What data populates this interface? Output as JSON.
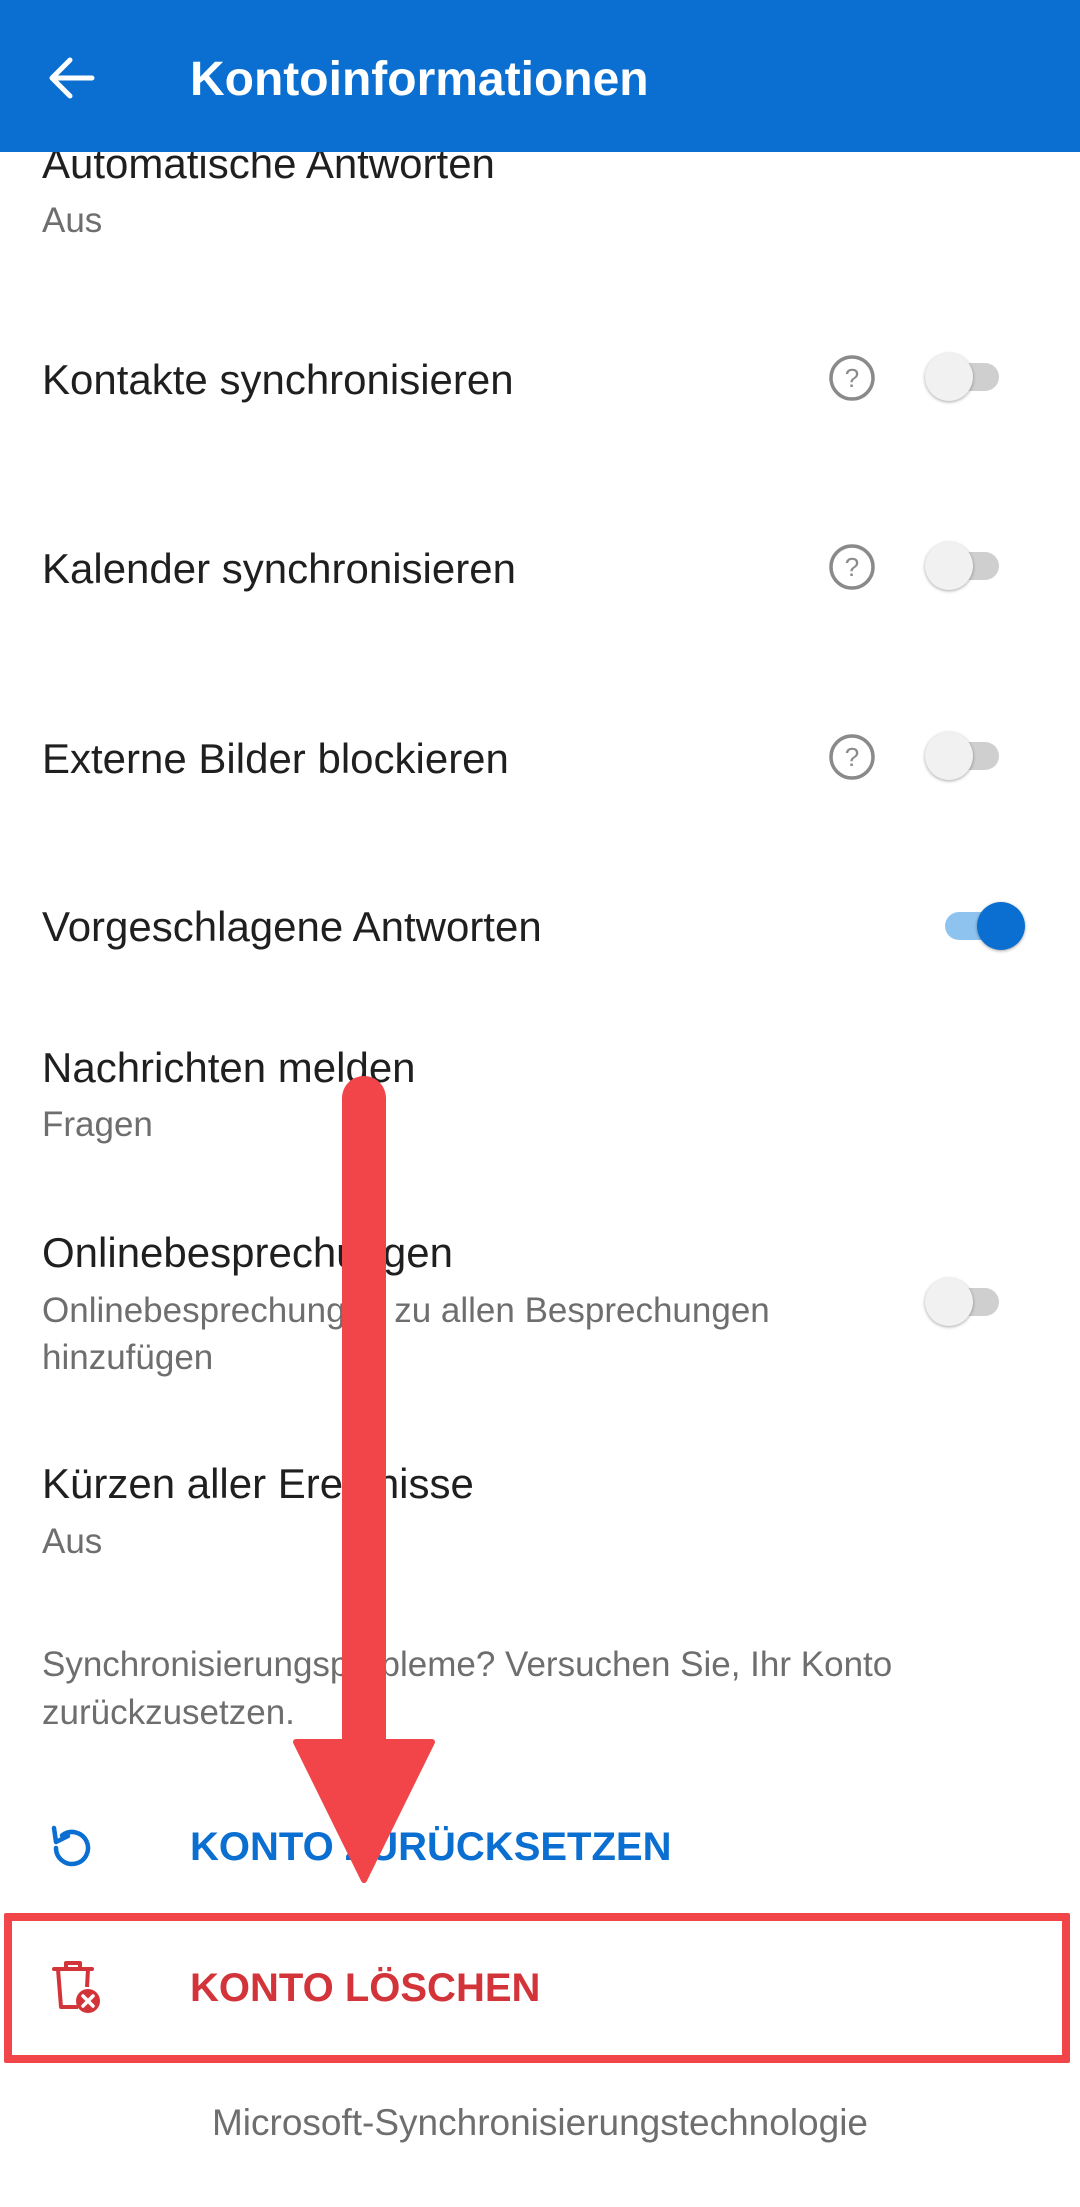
{
  "appbar": {
    "title": "Kontoinformationen"
  },
  "settings": {
    "auto_reply": {
      "label": "Automatische Antworten",
      "value": "Aus"
    },
    "sync_contacts": {
      "label": "Kontakte synchronisieren",
      "enabled": false
    },
    "sync_calendar": {
      "label": "Kalender synchronisieren",
      "enabled": false
    },
    "block_images": {
      "label": "Externe Bilder blockieren",
      "enabled": false
    },
    "suggested_replies": {
      "label": "Vorgeschlagene Antworten",
      "enabled": true
    },
    "report_messages": {
      "label": "Nachrichten melden",
      "value": "Fragen"
    },
    "online_meetings": {
      "label": "Onlinebesprechungen",
      "description_line1": "Onlinebesprechungen zu allen Besprechungen",
      "description_line2": "hinzufügen",
      "enabled": false
    },
    "shorten_events": {
      "label": "Kürzen aller Ereignisse",
      "value": "Aus"
    }
  },
  "sync_hint": {
    "line1": "Synchronisierungsprobleme? Versuchen Sie, Ihr Konto",
    "line2": "zurückzusetzen."
  },
  "actions": {
    "reset_label": "KONTO ZURÜCKSETZEN",
    "delete_label": "KONTO LÖSCHEN"
  },
  "footer": {
    "text": "Microsoft-Synchronisierungstechnologie"
  },
  "colors": {
    "appbar": "#0a6fd0",
    "accent": "#0a6fd0",
    "danger": "#d2343a",
    "annotation": "#f2454a"
  },
  "icons": {
    "back": "arrow-left-icon",
    "help": "question-circle-icon",
    "reset": "refresh-icon",
    "delete": "trash-delete-icon"
  }
}
